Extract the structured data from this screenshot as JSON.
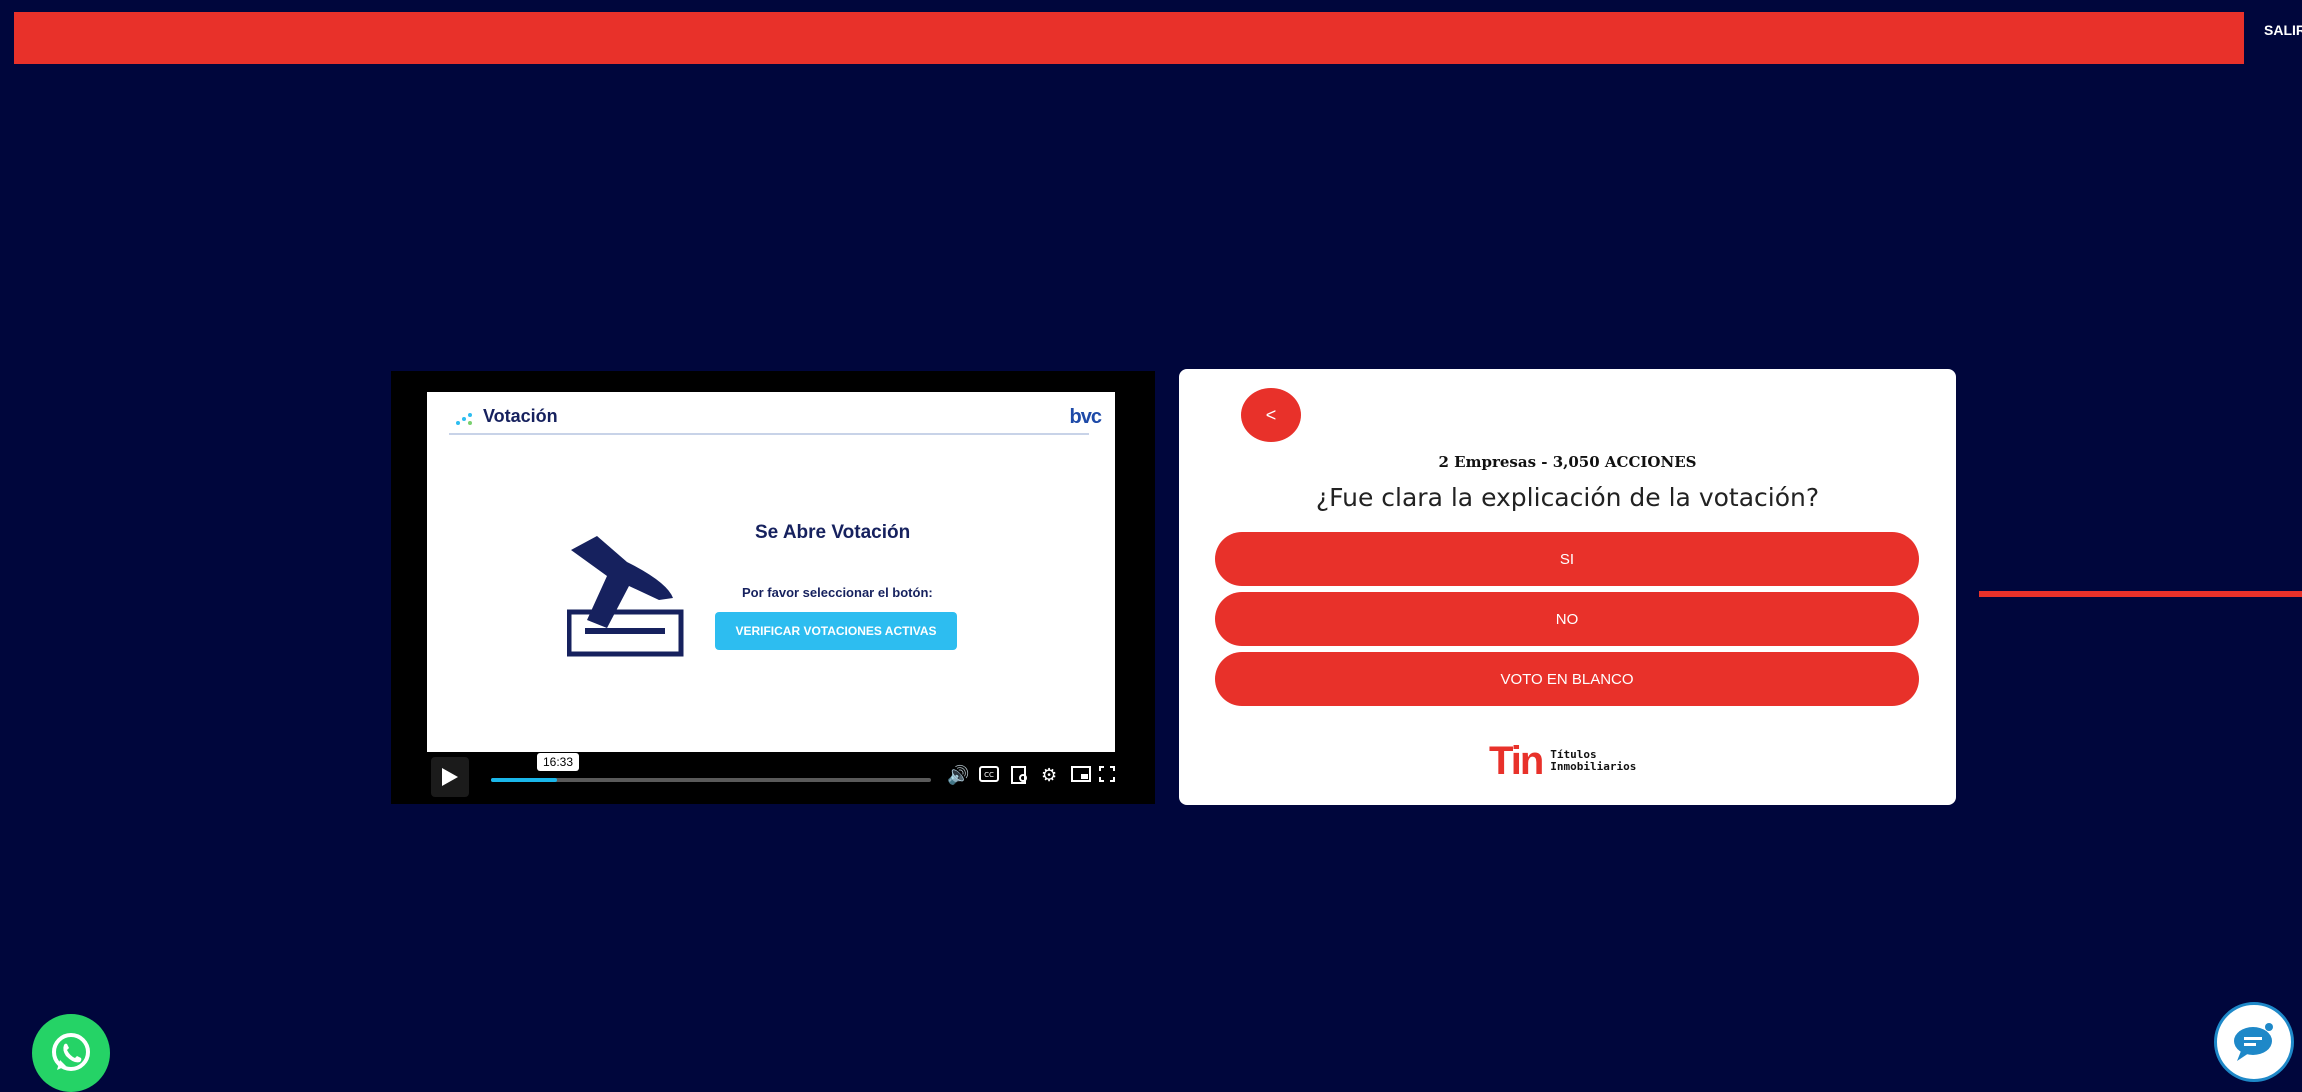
{
  "header": {
    "logout_label": "SALIR"
  },
  "video": {
    "slide": {
      "title": "Votación",
      "logo_text": "bvc",
      "heading": "Se Abre Votación",
      "subheading": "Por favor seleccionar el botón:",
      "button_label": "VERIFICAR VOTACIONES ACTIVAS"
    },
    "player": {
      "time_tooltip": "16:33",
      "progress_percent": 15,
      "icons": [
        "play-icon",
        "volume-icon",
        "captions-icon",
        "transcript-icon",
        "settings-icon",
        "pip-icon",
        "fullscreen-icon"
      ]
    }
  },
  "vote_panel": {
    "back_label": "<",
    "meta": "2 Empresas - 3,050 ACCIONES",
    "question": "¿Fue clara la explicación de la votación?",
    "options": [
      "SI",
      "NO",
      "VOTO EN BLANCO"
    ],
    "brand": {
      "mark": "Tin",
      "line1": "Títulos",
      "line2": "Inmobiliarios"
    }
  },
  "colors": {
    "background": "#00063c",
    "accent": "#e8312a",
    "whatsapp": "#25d366",
    "slide_button": "#2dbdf0"
  },
  "floating": {
    "whatsapp_icon": "whatsapp-icon",
    "chat_icon": "chat-support-icon"
  }
}
